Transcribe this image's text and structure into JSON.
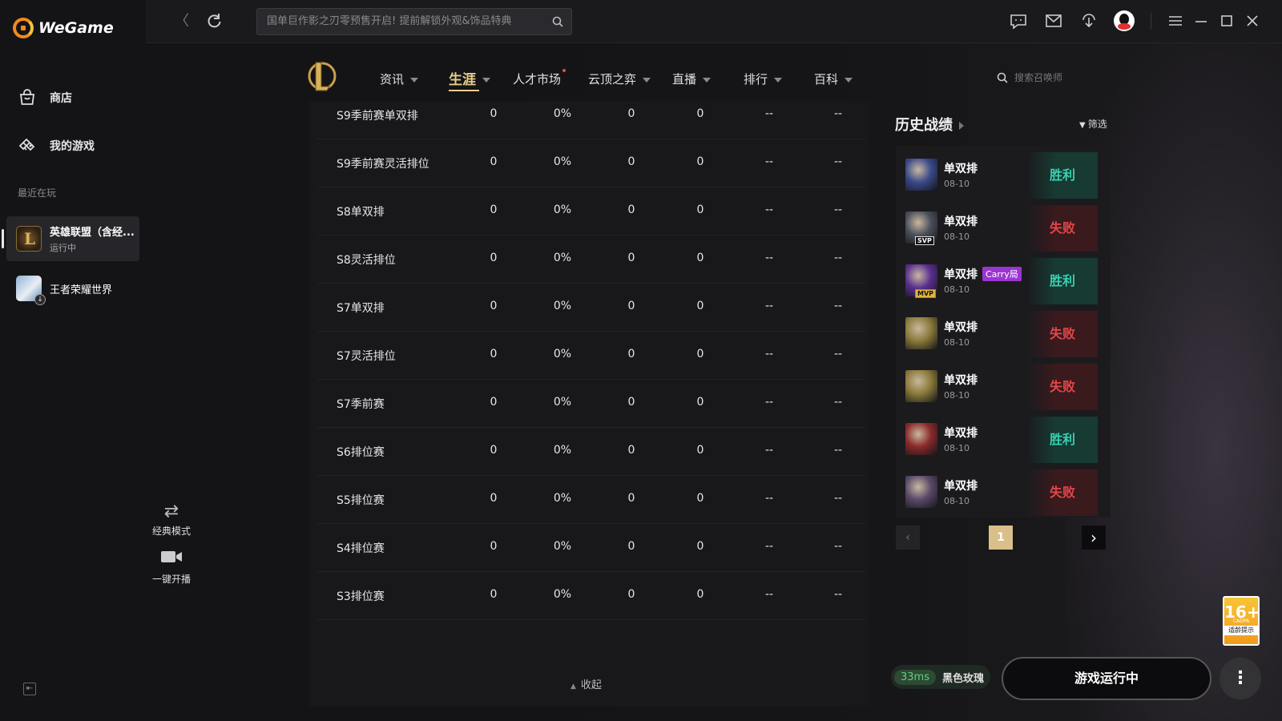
{
  "app": {
    "logo_text": "WeGame"
  },
  "sidebar": {
    "nav": [
      {
        "label": "商店",
        "icon": "store-icon"
      },
      {
        "label": "我的游戏",
        "icon": "controller-icon"
      }
    ],
    "recent_label": "最近在玩",
    "games": [
      {
        "name": "英雄联盟（含经...",
        "status": "运行中"
      },
      {
        "name": "王者荣耀世界",
        "status": ""
      }
    ]
  },
  "topbar": {
    "search_placeholder": "国单巨作影之刃零预售开启! 提前解锁外观&饰品特典"
  },
  "game_nav": {
    "tabs": [
      {
        "label": "资讯",
        "caret": true,
        "dot": false,
        "selected": false
      },
      {
        "label": "生涯",
        "caret": true,
        "dot": false,
        "selected": true
      },
      {
        "label": "人才市场",
        "caret": false,
        "dot": true,
        "selected": false
      },
      {
        "label": "云顶之弈",
        "caret": true,
        "dot": false,
        "selected": false
      },
      {
        "label": "直播",
        "caret": true,
        "dot": false,
        "selected": false
      },
      {
        "label": "排行",
        "caret": true,
        "dot": false,
        "selected": false
      },
      {
        "label": "百科",
        "caret": true,
        "dot": false,
        "selected": false
      }
    ],
    "summoner_search_placeholder": "搜索召唤师"
  },
  "ranked_table": {
    "rows": [
      [
        "S9季前赛单双排",
        "0",
        "0%",
        "0",
        "0",
        "--",
        "--"
      ],
      [
        "S9季前赛灵活排位",
        "0",
        "0%",
        "0",
        "0",
        "--",
        "--"
      ],
      [
        "S8单双排",
        "0",
        "0%",
        "0",
        "0",
        "--",
        "--"
      ],
      [
        "S8灵活排位",
        "0",
        "0%",
        "0",
        "0",
        "--",
        "--"
      ],
      [
        "S7单双排",
        "0",
        "0%",
        "0",
        "0",
        "--",
        "--"
      ],
      [
        "S7灵活排位",
        "0",
        "0%",
        "0",
        "0",
        "--",
        "--"
      ],
      [
        "S7季前赛",
        "0",
        "0%",
        "0",
        "0",
        "--",
        "--"
      ],
      [
        "S6排位赛",
        "0",
        "0%",
        "0",
        "0",
        "--",
        "--"
      ],
      [
        "S5排位赛",
        "0",
        "0%",
        "0",
        "0",
        "--",
        "--"
      ],
      [
        "S4排位赛",
        "0",
        "0%",
        "0",
        "0",
        "--",
        "--"
      ],
      [
        "S3排位赛",
        "0",
        "0%",
        "0",
        "0",
        "--",
        "--"
      ]
    ],
    "collapse_label": "收起"
  },
  "history": {
    "title": "历史战绩",
    "filter_label": "筛选",
    "matches": [
      {
        "queue": "单双排",
        "date": "08-10",
        "result": "胜利",
        "win": true,
        "badge": "",
        "carry": "",
        "color": "#3b4a8a"
      },
      {
        "queue": "单双排",
        "date": "08-10",
        "result": "失败",
        "win": false,
        "badge": "SVP",
        "carry": "",
        "color": "#4a4f5a"
      },
      {
        "queue": "单双排",
        "date": "08-10",
        "result": "胜利",
        "win": true,
        "badge": "MVP",
        "carry": "Carry局",
        "color": "#5a2f8f"
      },
      {
        "queue": "单双排",
        "date": "08-10",
        "result": "失败",
        "win": false,
        "badge": "",
        "carry": "",
        "color": "#8a7a3a"
      },
      {
        "queue": "单双排",
        "date": "08-10",
        "result": "失败",
        "win": false,
        "badge": "",
        "carry": "",
        "color": "#8a7a3a"
      },
      {
        "queue": "单双排",
        "date": "08-10",
        "result": "胜利",
        "win": true,
        "badge": "",
        "carry": "",
        "color": "#8a2a2a"
      },
      {
        "queue": "单双排",
        "date": "08-10",
        "result": "失败",
        "win": false,
        "badge": "",
        "carry": "",
        "color": "#5a4a6a"
      }
    ],
    "current_page": "1"
  },
  "overlay": {
    "mode_label": "经典模式",
    "stream_label": "一键开播"
  },
  "bottom": {
    "ping": "33ms",
    "server": "黑色玫瑰",
    "launch_label": "游戏运行中",
    "age_rating": "16+",
    "age_tag": "CADPA",
    "age_tip": "适龄提示"
  },
  "colors": {
    "accent_gold": "#e8cc8a",
    "win": "#3ad0b0",
    "lose": "#e4464a"
  }
}
